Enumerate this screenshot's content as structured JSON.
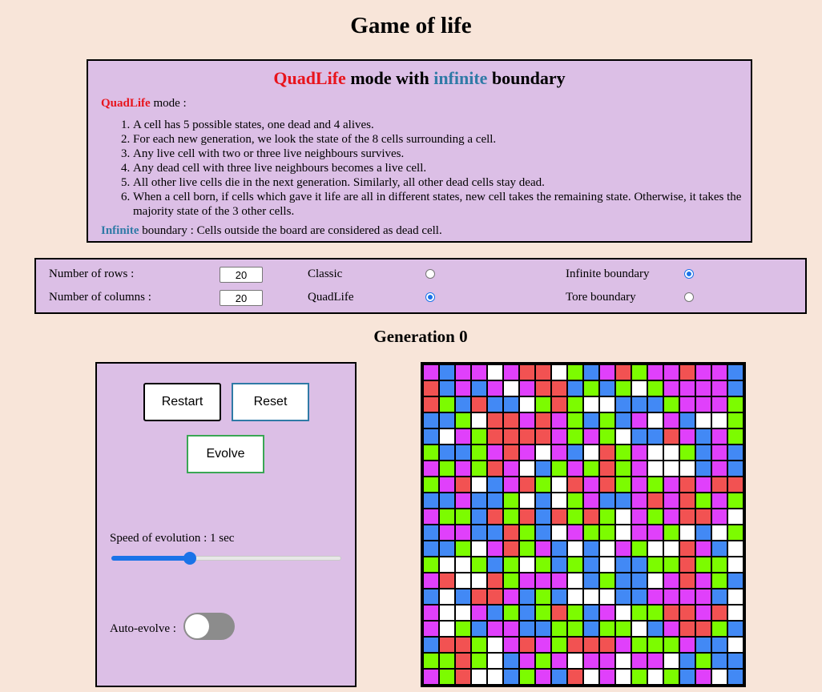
{
  "page": {
    "title": "Game of life"
  },
  "rules": {
    "heading": {
      "mode": "QuadLife",
      "mid": " mode with ",
      "boundary": "infinite",
      "end": " boundary"
    },
    "mode_name": "QuadLife",
    "mode_suffix": " mode :",
    "items": [
      "A cell has 5 possible states, one dead and 4 alives.",
      "For each new generation, we look the state of the 8 cells surrounding a cell.",
      "Any live cell with two or three live neighbours survives.",
      "Any dead cell with three live neighbours becomes a live cell.",
      "All other live cells die in the next generation. Similarly, all other dead cells stay dead.",
      "When a cell born, if cells which gave it life are all in different states, new cell takes the remaining state. Otherwise, it takes the majority state of the 3 other cells."
    ],
    "boundary_name": "Infinite",
    "boundary_text": " boundary : Cells outside the board are considered as dead cell."
  },
  "settings": {
    "rows_label": "Number of rows :",
    "rows_value": "20",
    "cols_label": "Number of columns :",
    "cols_value": "20",
    "classic_label": "Classic",
    "quadlife_label": "QuadLife",
    "mode_selected": "QuadLife",
    "infinite_label": "Infinite boundary",
    "tore_label": "Tore boundary",
    "boundary_selected": "Infinite boundary"
  },
  "generation": "Generation 0",
  "controls": {
    "restart_label": "Restart",
    "reset_label": "Reset",
    "evolve_label": "Evolve",
    "speed_label": "Speed of evolution : 1 sec",
    "speed_fraction": 0.34,
    "auto_label": "Auto-evolve :",
    "auto_on": false
  },
  "board": {
    "colors": {
      "M": "#e040fb",
      "R": "#f25252",
      "B": "#4289f5",
      "G": "#7cfc00",
      "W": "#ffffff"
    },
    "rows": [
      "MBMMWMRRWGBMRGMMRMMB",
      "RBMBMWMRRBGBGWGMMMMB",
      "RGBRBBWGRGWWBBBGMMMG",
      "BBGWRRMRMGBGBMWMBWWG",
      "BWMGRRRRMGMGWBBRMBMG",
      "GBBGMRMWMBWRGMWWGBMB",
      "MGMGRMWBGMGRGMWWWBMB",
      "GMRWBMRGWRMRGMGMRMRR",
      "BBMBBGWBWGMBBMRMRGMG",
      "MGGBRGRBRGRGWMGMRRMW",
      "BMMBBRGBWMGGWMMGWBWG",
      "BBGWMRGMBWBWMGWWRMBW",
      "GWWGBGWGBGBWBBGGRGGW",
      "MRWWRGMMMWBGBBWMRMGB",
      "BWBRRMBGBWWWBBMMMMBW",
      "MWWMBGBGRGBMWGGRRMRW",
      "MWGBMMBBGGBGGWBMRRGB",
      "BRRGWMRMGRRRMGGGMBBW",
      "GGRGWBMGMWMMWMMWBGBB",
      "MGRWWBGMBRWMWGWGBMWB"
    ]
  }
}
